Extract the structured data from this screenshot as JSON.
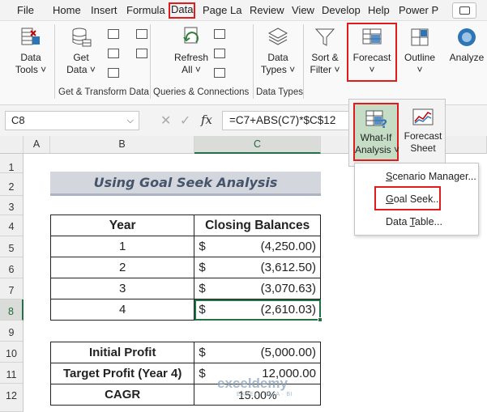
{
  "menu": {
    "tabs": [
      "File",
      "Home",
      "Insert",
      "Formula",
      "Data",
      "Page La",
      "Review",
      "View",
      "Develop",
      "Help",
      "Power P"
    ],
    "active_tab": "Data"
  },
  "ribbon": {
    "data_tools": "Data\nTools ˅",
    "get_data": "Get\nData ˅",
    "refresh_all": "Refresh\nAll ˅",
    "data_types": "Data\nTypes ˅",
    "sort_filter": "Sort &\nFilter ˅",
    "forecast": "Forecast\n˅",
    "outline": "Outline\n˅",
    "analyze": "Analyze\n",
    "group_get_transform": "Get & Transform Data",
    "group_queries": "Queries & Connections",
    "group_data_types": "Data Types"
  },
  "forecast_panel": {
    "what_if": "What-If\nAnalysis ˅",
    "forecast_sheet": "Forecast\nSheet"
  },
  "what_if_menu": {
    "items": [
      "Scenario Manager...",
      "Goal Seek...",
      "Data Table..."
    ],
    "underline": [
      "S",
      "G",
      "T"
    ],
    "highlighted": "Goal Seek..."
  },
  "formula_bar": {
    "name_box": "C8",
    "formula": "=C7+ABS(C7)*$C$12"
  },
  "columns": [
    "A",
    "B",
    "C"
  ],
  "rows": [
    "1",
    "2",
    "3",
    "4",
    "5",
    "6",
    "7",
    "8",
    "9",
    "10",
    "11",
    "12"
  ],
  "sheet": {
    "title": "Using Goal Seek Analysis",
    "table1": {
      "headers": [
        "Year",
        "Closing Balances"
      ],
      "rows": [
        {
          "year": "1",
          "symbol": "$",
          "value": "(4,250.00)"
        },
        {
          "year": "2",
          "symbol": "$",
          "value": "(3,612.50)"
        },
        {
          "year": "3",
          "symbol": "$",
          "value": "(3,070.63)"
        },
        {
          "year": "4",
          "symbol": "$",
          "value": "(2,610.03)"
        }
      ]
    },
    "table2": {
      "initial_profit_label": "Initial Profit",
      "initial_profit_symbol": "$",
      "initial_profit_value": "(5,000.00)",
      "target_profit_label": "Target Profit (Year 4)",
      "target_profit_symbol": "$",
      "target_profit_value": "12,000.00",
      "cagr_label": "CAGR",
      "cagr_value": "15.00%"
    }
  },
  "watermark": {
    "brand": "exceldemy",
    "tagline": "EXCEL · DATA · BI"
  },
  "colors": {
    "highlight_red": "#e01b1b",
    "excel_green": "#217346",
    "title_band": "#d3d6dc",
    "title_text": "#44546a"
  }
}
